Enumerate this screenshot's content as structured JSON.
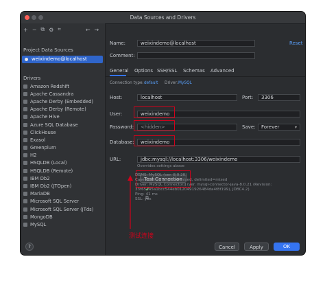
{
  "window": {
    "title": "Data Sources and Drivers"
  },
  "left": {
    "section_project": "Project Data Sources",
    "selected_source": "weixindemo@localhost",
    "section_drivers": "Drivers",
    "drivers": [
      "Amazon Redshift",
      "Apache Cassandra",
      "Apache Derby (Embedded)",
      "Apache Derby (Remote)",
      "Apache Hive",
      "Azure SQL Database",
      "ClickHouse",
      "Exasol",
      "Greenplum",
      "H2",
      "HSQLDB (Local)",
      "HSQLDB (Remote)",
      "IBM Db2",
      "IBM Db2 (JTOpen)",
      "MariaDB",
      "Microsoft SQL Server",
      "Microsoft SQL Server (jTds)",
      "MongoDB",
      "MySQL"
    ]
  },
  "form": {
    "name_label": "Name:",
    "name_value": "weixindemo@localhost",
    "reset": "Reset",
    "comment_label": "Comment:",
    "tabs": [
      "General",
      "Options",
      "SSH/SSL",
      "Schemas",
      "Advanced"
    ],
    "conn_type_label": "Connection type:",
    "conn_type_value": "default",
    "driver_label": "Driver:",
    "driver_value": "MySQL",
    "host_label": "Host:",
    "host_value": "localhost",
    "port_label": "Port:",
    "port_value": "3306",
    "user_label": "User:",
    "user_value": "weixindemo",
    "password_label": "Password:",
    "password_value": "<hidden>",
    "save_label": "Save:",
    "save_value": "Forever",
    "database_label": "Database:",
    "database_value": "weixindemo",
    "url_label": "URL:",
    "url_value": "jdbc:mysql://localhost:3306/weixindemo",
    "url_hint": "Overrides settings above",
    "test_button": "Test Connection",
    "status_lines": [
      "DBMS: MySQL (ver. 8.0.20)",
      "Case sensitivity: plain=mixed, delimited=mixed",
      "Driver: MySQL Connector/J (ver. mysql-connector-java-8.0.21 (Revision:",
      "33f65445a1bcc544eb0120491926484da4f8f199), JDBC4.2)",
      "Ping: 41 ms",
      "SSL: yes"
    ]
  },
  "annotation": "测试连接",
  "footer": {
    "help": "?",
    "cancel": "Cancel",
    "apply": "Apply",
    "ok": "OK"
  }
}
